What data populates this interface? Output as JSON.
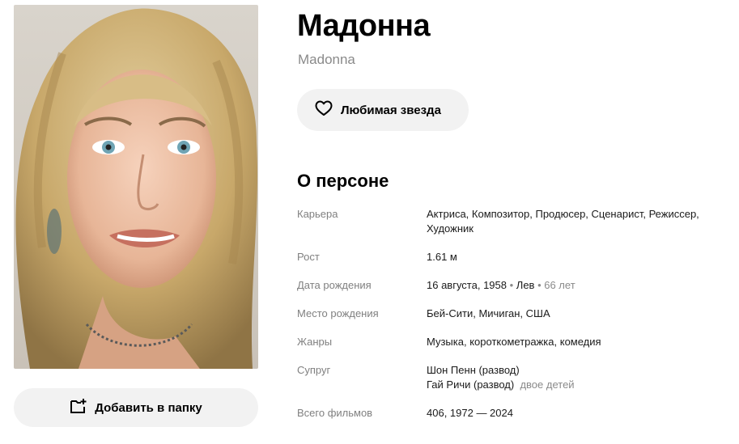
{
  "person": {
    "name": "Мадонна",
    "original_name": "Madonna",
    "favorite_label": "Любимая звезда",
    "add_to_folder_label": "Добавить в папку"
  },
  "about": {
    "title": "О персоне",
    "career": {
      "label": "Карьера",
      "value": "Актриса, Композитор, Продюсер, Сценарист, Режиссер, Художник"
    },
    "height": {
      "label": "Рост",
      "value": "1.61 м"
    },
    "birth_date": {
      "label": "Дата рождения",
      "date": "16 августа, 1958",
      "sign": "Лев",
      "age": "66 лет",
      "sep": " • "
    },
    "birth_place": {
      "label": "Место рождения",
      "value": "Бей-Сити, Мичиган, США"
    },
    "genres": {
      "label": "Жанры",
      "value": "Музыка, короткометражка, комедия"
    },
    "spouse": {
      "label": "Супруг",
      "first": "Шон Пенн (развод)",
      "second": "Гай Ричи (развод)",
      "children": "двое детей"
    },
    "total_films": {
      "label": "Всего фильмов",
      "value": "406, 1972 — 2024"
    }
  },
  "icons": {
    "favorite": "heart-icon",
    "folder": "folder-add-icon"
  }
}
